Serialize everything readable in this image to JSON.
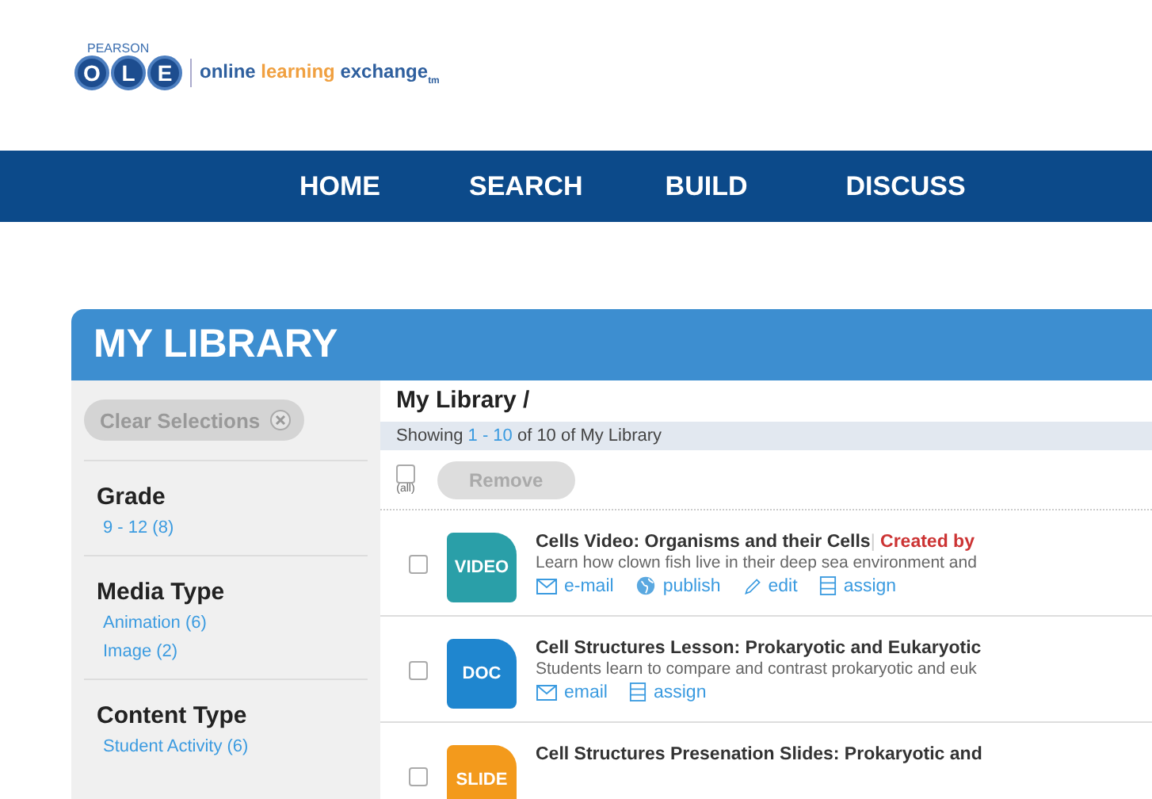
{
  "brand": {
    "publisher": "PEARSON",
    "logo_letters": [
      "O",
      "L",
      "E"
    ],
    "tagline_parts": [
      "online ",
      "learning",
      " exchange"
    ],
    "tm": "tm"
  },
  "nav": [
    {
      "label": "HOME"
    },
    {
      "label": "SEARCH"
    },
    {
      "label": "BUILD"
    },
    {
      "label": "DISCUSS"
    }
  ],
  "library": {
    "title": "MY LIBRARY",
    "sidebar": {
      "clear_button": "Clear Selections",
      "facets": [
        {
          "heading": "Grade",
          "options": [
            "9 - 12 (8)"
          ]
        },
        {
          "heading": "Media Type",
          "options": [
            "Animation (6)",
            "Image (2)"
          ]
        },
        {
          "heading": "Content Type",
          "options": [
            "Student Activity (6)"
          ]
        }
      ]
    },
    "breadcrumb": "My Library /",
    "showing": {
      "prefix": "Showing ",
      "range": "1 - 10",
      "suffix": " of 10 of My Library"
    },
    "select_all": {
      "label": "(all)",
      "checked": false
    },
    "remove_button": {
      "label": "Remove",
      "disabled": true
    },
    "items": [
      {
        "type": "VIDEO",
        "color": "#2a9fa8",
        "checked": false,
        "title": "Cells Video: Organisms and their Cells",
        "separator": "|",
        "creator": "Created by",
        "description": "Learn how clown fish live in their deep sea environment and",
        "actions": [
          {
            "kind": "email",
            "label": "e-mail"
          },
          {
            "kind": "publish",
            "label": "publish"
          },
          {
            "kind": "edit",
            "label": "edit"
          },
          {
            "kind": "assign",
            "label": "assign"
          }
        ]
      },
      {
        "type": "DOC",
        "color": "#1f86cf",
        "checked": false,
        "title": "Cell Structures Lesson: Prokaryotic and Eukaryotic",
        "description": "Students learn to compare and contrast prokaryotic and euk",
        "actions": [
          {
            "kind": "email",
            "label": "email"
          },
          {
            "kind": "assign",
            "label": "assign"
          }
        ]
      },
      {
        "type": "SLIDE",
        "color": "#f39a1c",
        "checked": false,
        "title": "Cell Structures Presenation Slides: Prokaryotic and"
      }
    ]
  }
}
